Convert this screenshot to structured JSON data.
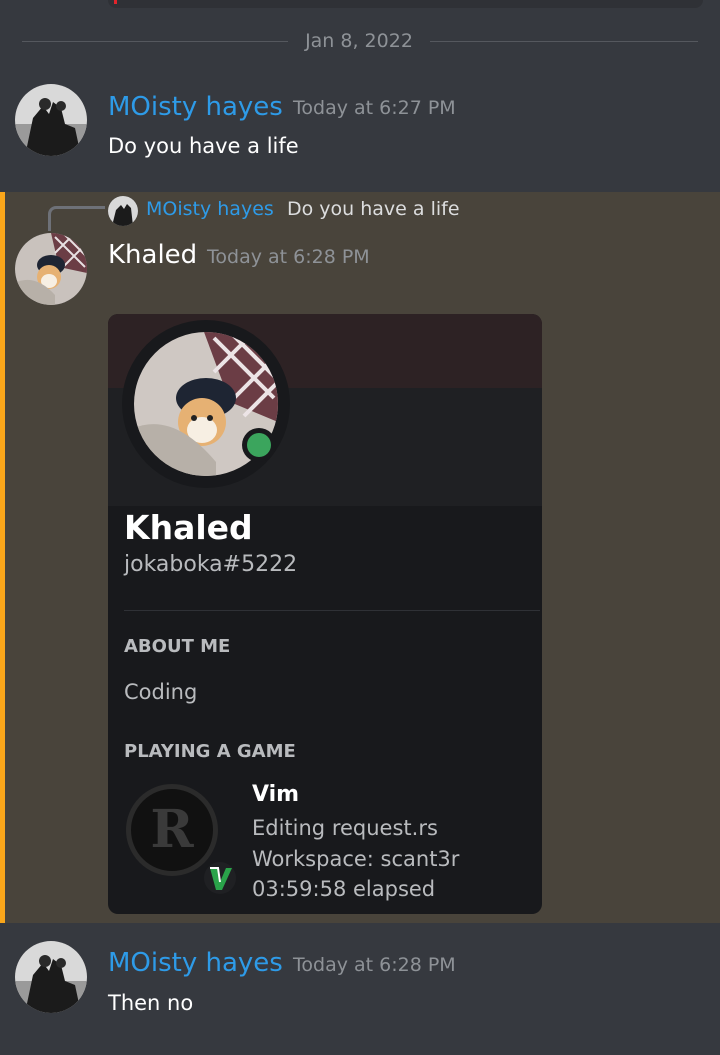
{
  "divider": {
    "date": "Jan 8, 2022"
  },
  "messages": [
    {
      "author": "MOisty hayes",
      "timestamp": "Today at 6:27 PM",
      "content": "Do you have a life"
    },
    {
      "author": "Khaled",
      "timestamp": "Today at 6:28 PM",
      "reply": {
        "author": "MOisty hayes",
        "content": "Do you have a life"
      },
      "profile_card": {
        "display_name": "Khaled",
        "tag": "jokaboka#5222",
        "status": "online",
        "about_title": "ABOUT ME",
        "about_text": "Coding",
        "activity_title": "PLAYING A GAME",
        "game": {
          "name": "Vim",
          "details": "Editing request.rs",
          "state": "Workspace: scant3r",
          "elapsed": "03:59:58 elapsed"
        }
      }
    },
    {
      "author": "MOisty hayes",
      "timestamp": "Today at 6:28 PM",
      "content": "Then no"
    }
  ],
  "colors": {
    "mention_highlight": "#49443b",
    "mention_bar": "#faa61a",
    "author_blue": "#2e9be8",
    "online": "#3ba55d"
  }
}
